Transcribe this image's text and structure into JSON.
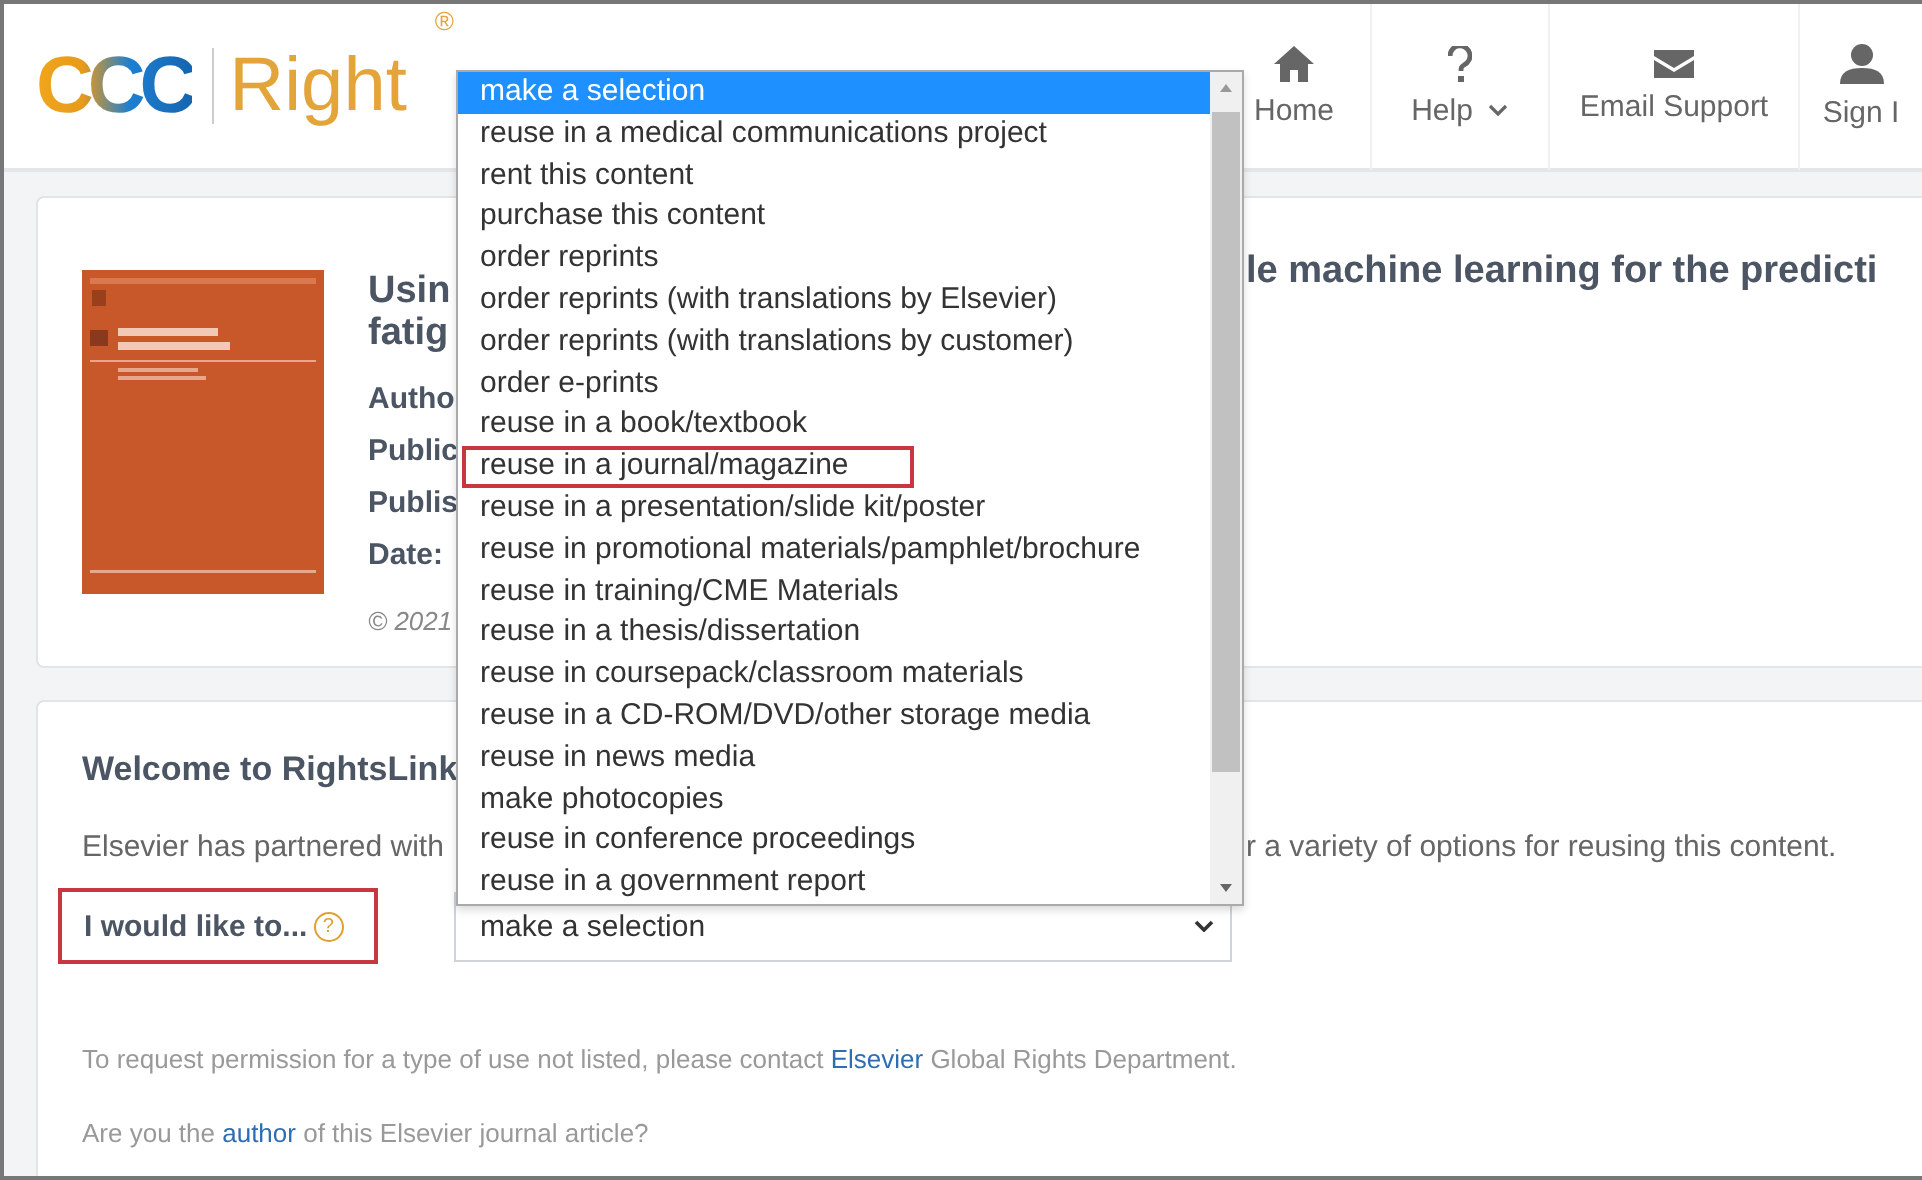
{
  "header": {
    "logo_mark": "CCC",
    "logo_word": "Right",
    "logo_registered": "®",
    "nav": [
      {
        "label": "Home",
        "has_menu": false
      },
      {
        "label": "Help",
        "has_menu": true
      },
      {
        "label": "Email Support",
        "has_menu": false
      },
      {
        "label": "Sign I",
        "has_menu": false
      }
    ]
  },
  "article": {
    "cover": {
      "kind": "picture"
    },
    "title_left": [
      "Usin",
      "fatig"
    ],
    "title_right": "le machine learning for the predicti",
    "meta": [
      "Autho",
      "Public",
      "Publis",
      "Date:"
    ],
    "copyright": "© 2021"
  },
  "welcome": {
    "title": "Welcome to RightsLink",
    "intro_left": "Elsevier has partnered with",
    "intro_right": "r a variety of options for reusing this content.",
    "prompt": {
      "label": "I would like to...",
      "help": "?",
      "marked": true
    },
    "select": {
      "value": "make a selection",
      "expanded": true
    },
    "note_parts": [
      "To request permission for a type of use not listed, please contact ",
      "Elsevier",
      " Global Rights Department."
    ],
    "author_parts": [
      "Are you the ",
      "author",
      " of this Elsevier journal article?"
    ]
  },
  "options": [
    {
      "label": "make a selection",
      "selected": true,
      "marked": false
    },
    {
      "label": "reuse in a medical communications project",
      "selected": false,
      "marked": false
    },
    {
      "label": "rent this content",
      "selected": false,
      "marked": false
    },
    {
      "label": "purchase this content",
      "selected": false,
      "marked": false
    },
    {
      "label": "order reprints",
      "selected": false,
      "marked": false
    },
    {
      "label": "order reprints (with translations by Elsevier)",
      "selected": false,
      "marked": false
    },
    {
      "label": "order reprints (with translations by customer)",
      "selected": false,
      "marked": false
    },
    {
      "label": "order e-prints",
      "selected": false,
      "marked": false
    },
    {
      "label": "reuse in a book/textbook",
      "selected": false,
      "marked": false
    },
    {
      "label": "reuse in a journal/magazine",
      "selected": false,
      "marked": true
    },
    {
      "label": "reuse in a presentation/slide kit/poster",
      "selected": false,
      "marked": false
    },
    {
      "label": "reuse in promotional materials/pamphlet/brochure",
      "selected": false,
      "marked": false
    },
    {
      "label": "reuse in training/CME Materials",
      "selected": false,
      "marked": false
    },
    {
      "label": "reuse in a thesis/dissertation",
      "selected": false,
      "marked": false
    },
    {
      "label": "reuse in coursepack/classroom materials",
      "selected": false,
      "marked": false
    },
    {
      "label": "reuse in a CD-ROM/DVD/other storage media",
      "selected": false,
      "marked": false
    },
    {
      "label": "reuse in news media",
      "selected": false,
      "marked": false
    },
    {
      "label": "make photocopies",
      "selected": false,
      "marked": false
    },
    {
      "label": "reuse in conference proceedings",
      "selected": false,
      "marked": false
    },
    {
      "label": "reuse in a government report",
      "selected": false,
      "marked": false
    }
  ]
}
